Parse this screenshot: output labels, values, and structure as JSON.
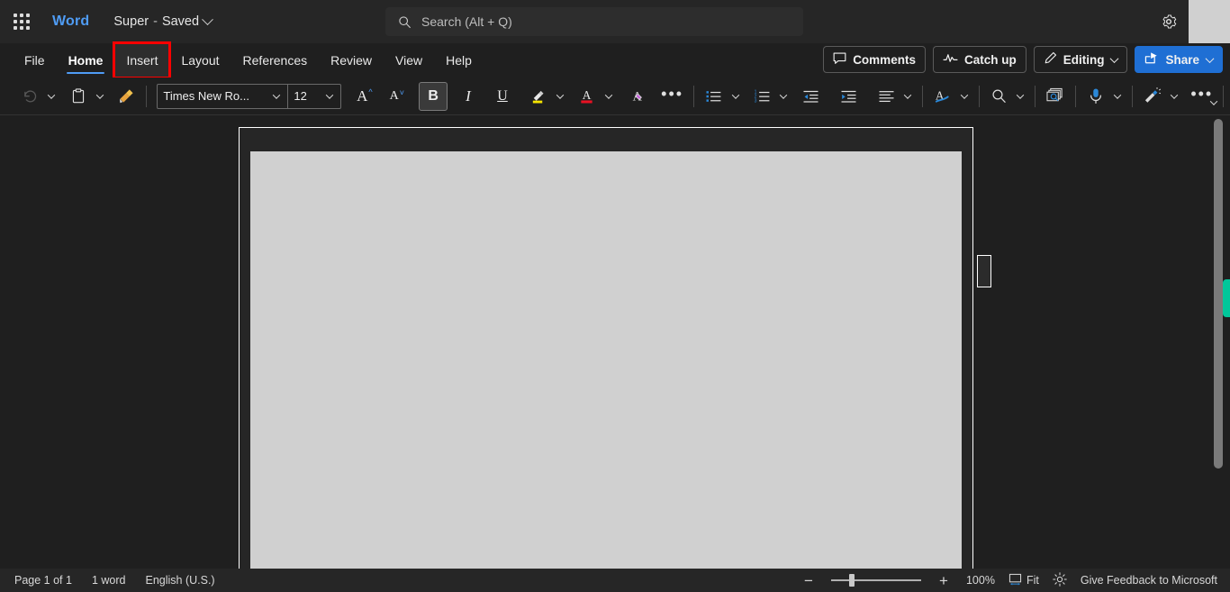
{
  "titlebar": {
    "waffle_label": "app-launcher",
    "app_name": "Word",
    "doc_name": "Super",
    "doc_separator": "-",
    "save_state": "Saved",
    "search_placeholder": "Search (Alt + Q)",
    "settings_label": "Settings"
  },
  "ribbon": {
    "tabs": [
      {
        "label": "File",
        "active": false,
        "highlighted": false
      },
      {
        "label": "Home",
        "active": true,
        "highlighted": false
      },
      {
        "label": "Insert",
        "active": false,
        "highlighted": true
      },
      {
        "label": "Layout",
        "active": false,
        "highlighted": false
      },
      {
        "label": "References",
        "active": false,
        "highlighted": false
      },
      {
        "label": "Review",
        "active": false,
        "highlighted": false
      },
      {
        "label": "View",
        "active": false,
        "highlighted": false
      },
      {
        "label": "Help",
        "active": false,
        "highlighted": false
      }
    ],
    "comments_label": "Comments",
    "catchup_label": "Catch up",
    "editing_label": "Editing",
    "share_label": "Share",
    "highlight_color": "#fe0000",
    "accent_color": "#4f9cf5",
    "share_color": "#1f6fd4"
  },
  "toolbar": {
    "undo": "Undo",
    "paste": "Paste",
    "format_painter": "Format Painter",
    "font_name": "Times New Ro...",
    "font_size": "12",
    "grow_font": "A",
    "shrink_font": "A",
    "bold": "B",
    "italic": "I",
    "underline": "U",
    "highlight": "Text Highlight Color",
    "font_color": "A",
    "clear_formatting": "Clear Formatting",
    "more_font": "•••",
    "bullets": "Bullets",
    "numbering": "Numbering",
    "decrease_indent": "Decrease Indent",
    "increase_indent": "Increase Indent",
    "align": "Alignment",
    "styles": "Styles",
    "find": "Find",
    "editor": "Editor",
    "dictate": "Dictate",
    "designer": "Designer",
    "more_options": "•••"
  },
  "document": {
    "page_label": "document-page",
    "content": ""
  },
  "statusbar": {
    "page_info": "Page 1 of 1",
    "word_count": "1 word",
    "language": "English (U.S.)",
    "zoom_minus": "−",
    "zoom_plus": "+",
    "zoom_level": "100%",
    "fit_label": "Fit",
    "focus_label": "Focus",
    "feedback_label": "Give Feedback to Microsoft",
    "scroll_marker_color": "#00c79a"
  }
}
